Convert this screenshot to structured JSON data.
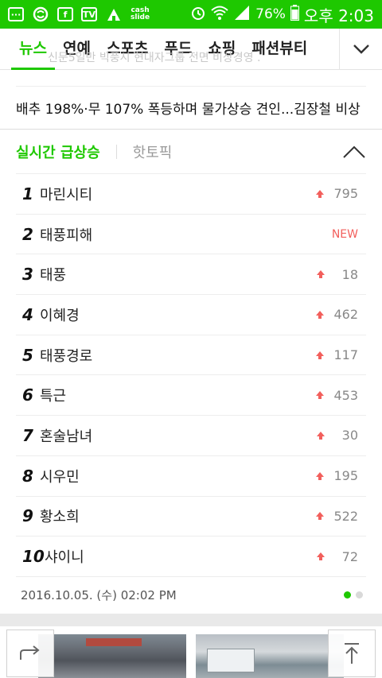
{
  "status_bar": {
    "icons": [
      "message-icon",
      "s-app-icon",
      "facebook-icon",
      "tv-icon",
      "home-icon",
      "cashslide-icon"
    ],
    "cash_label_1": "cash",
    "cash_label_2": "slide",
    "battery": "76%",
    "time": "오후 2:03"
  },
  "tabs": {
    "items": [
      {
        "label": "뉴스",
        "active": true
      },
      {
        "label": "연예",
        "active": false
      },
      {
        "label": "스포츠",
        "active": false
      },
      {
        "label": "푸드",
        "active": false
      },
      {
        "label": "쇼핑",
        "active": false
      },
      {
        "label": "패션뷰티",
        "active": false
      }
    ]
  },
  "ghost_text": "신문5일만 빅풍시 현대자그룹 전면 비상경영 .",
  "headline": "배추 198%·무 107% 폭등하며 물가상승 견인...김장철 비상",
  "ranking": {
    "tab_active": "실시간 급상승",
    "tab_other": "핫토픽",
    "items": [
      {
        "rank": "1",
        "keyword": "마린시티",
        "change": "795",
        "new": false
      },
      {
        "rank": "2",
        "keyword": "태풍피해",
        "change": "NEW",
        "new": true
      },
      {
        "rank": "3",
        "keyword": "태풍",
        "change": "18",
        "new": false
      },
      {
        "rank": "4",
        "keyword": "이혜경",
        "change": "462",
        "new": false
      },
      {
        "rank": "5",
        "keyword": "태풍경로",
        "change": "117",
        "new": false
      },
      {
        "rank": "6",
        "keyword": "특근",
        "change": "453",
        "new": false
      },
      {
        "rank": "7",
        "keyword": "혼술남녀",
        "change": "30",
        "new": false
      },
      {
        "rank": "8",
        "keyword": "시우민",
        "change": "195",
        "new": false
      },
      {
        "rank": "9",
        "keyword": "황소희",
        "change": "522",
        "new": false
      },
      {
        "rank": "10",
        "keyword": "샤이니",
        "change": "72",
        "new": false
      }
    ],
    "timestamp": "2016.10.05. (수) 02:02 PM",
    "page_dots": 2,
    "active_dot": 1
  },
  "colors": {
    "brand": "#1ec800",
    "up_arrow": "#f25f5c"
  }
}
